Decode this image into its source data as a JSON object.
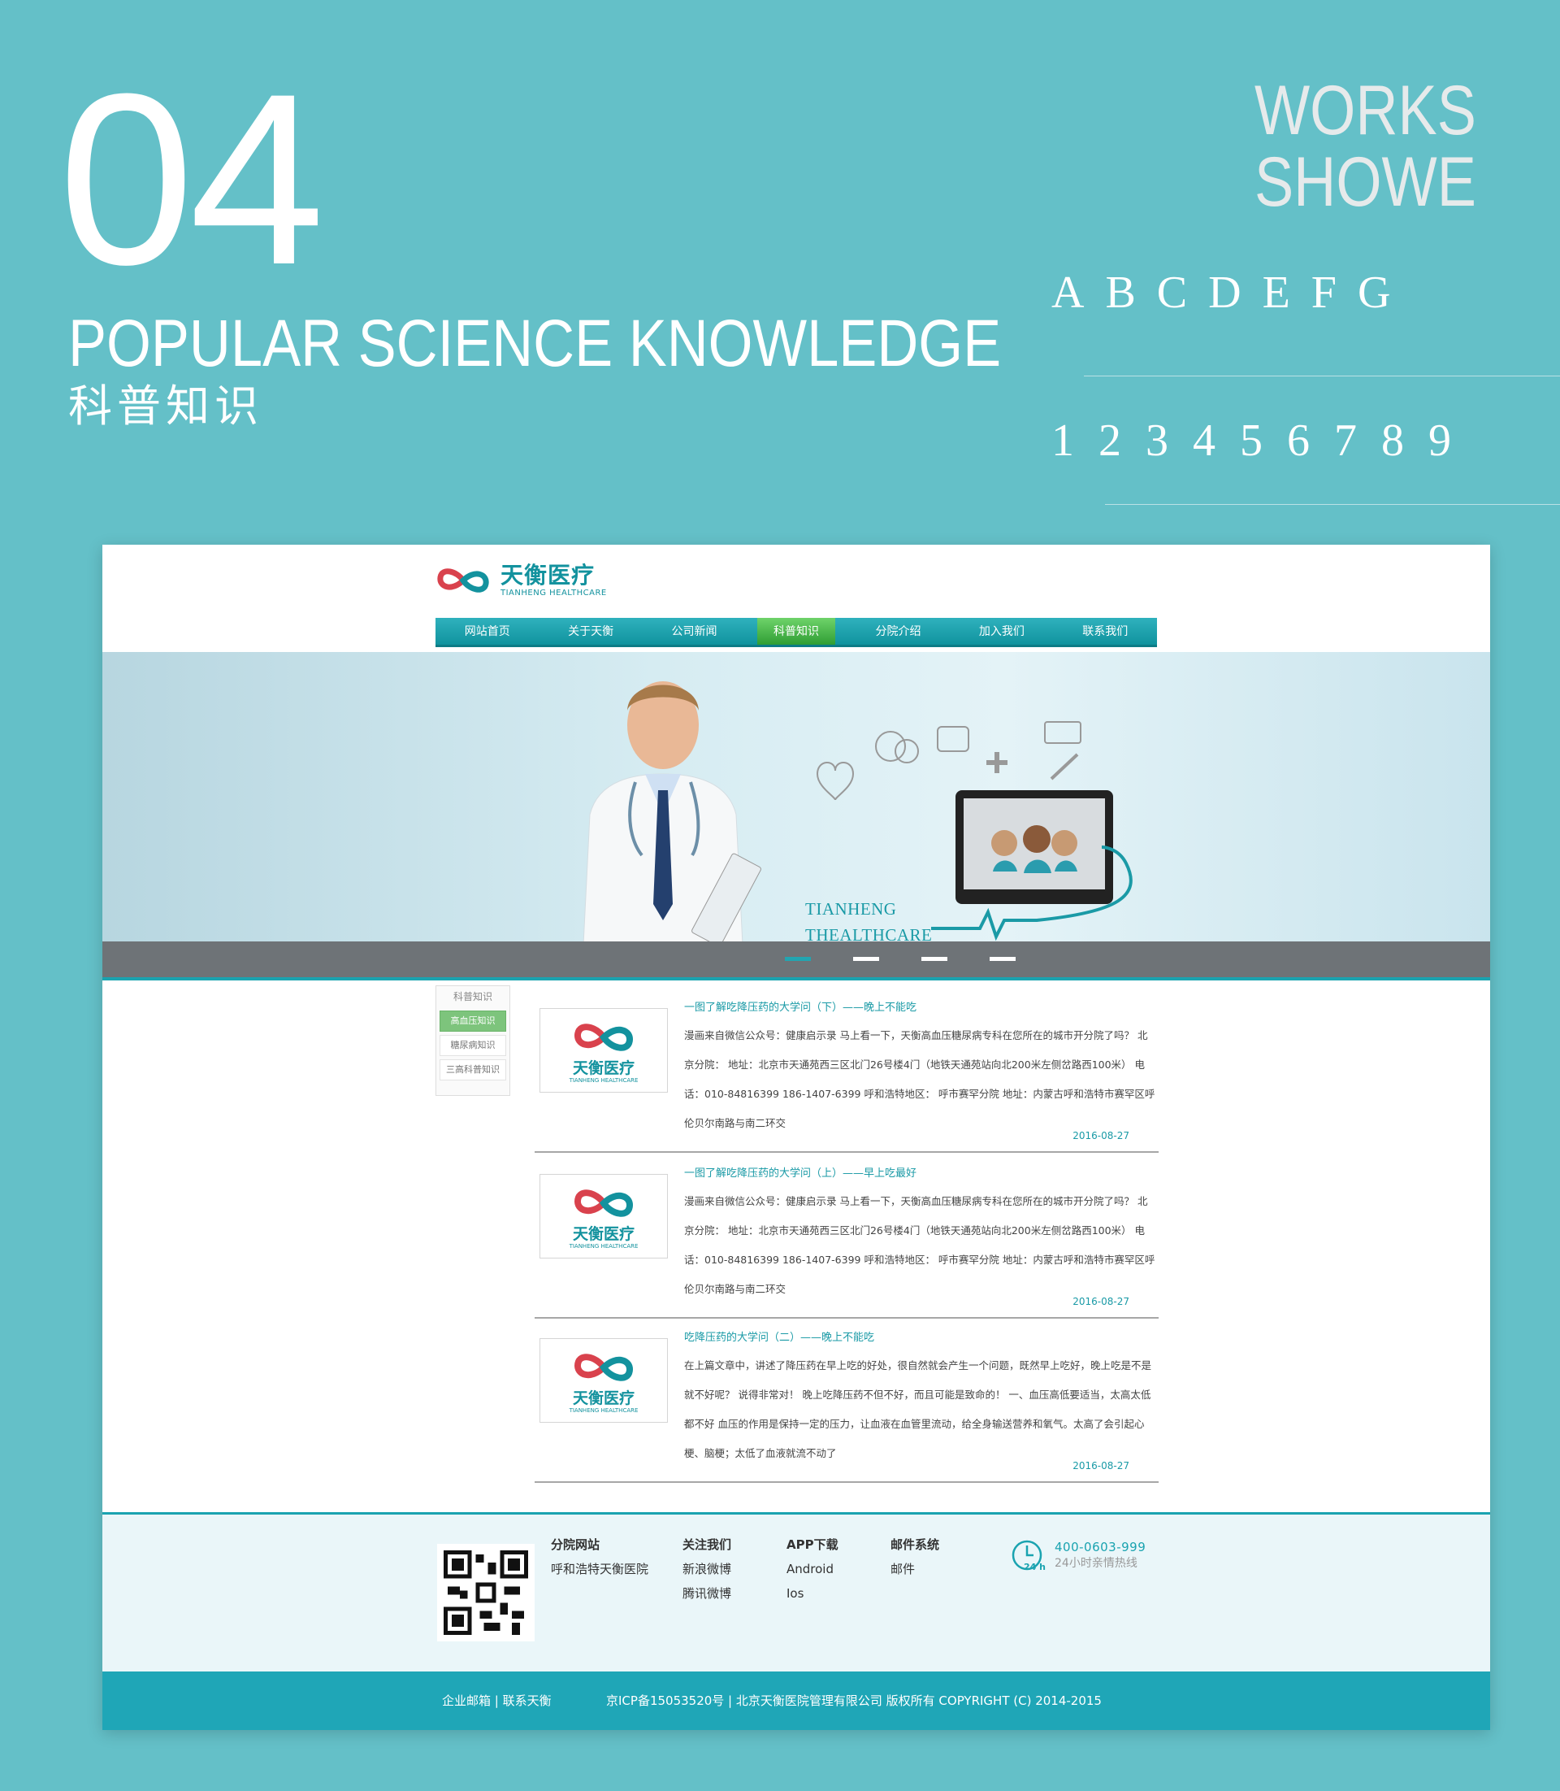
{
  "showcase": {
    "number": "04",
    "title": "POPULAR SCIENCE KNOWLEDGE",
    "title_cn": "科普知识",
    "works_line1": "WORKS",
    "works_line2": "SHOWE",
    "letters": "ABCDEFG",
    "digits": "123456789"
  },
  "site": {
    "logo_cn": "天衡医疗",
    "logo_en": "TIANHENG HEALTHCARE",
    "nav": [
      "网站首页",
      "关于天衡",
      "公司新闻",
      "科普知识",
      "分院介绍",
      "加入我们",
      "联系我们"
    ],
    "nav_active": "科普知识",
    "banner_line1": "TIANHENG",
    "banner_line2": "THEALTHCARE",
    "side_title": "科普知识",
    "side_items": [
      "高血压知识",
      "糖尿病知识",
      "三高科普知识"
    ],
    "articles": [
      {
        "title": "一图了解吃降压药的大学问（下）——晚上不能吃",
        "body": "漫画来自微信公众号：健康启示录 马上看一下，天衡高血压糖尿病专科在您所在的城市开分院了吗？ 北京分院： 地址：北京市天通苑西三区北门26号楼4门（地铁天通苑站向北200米左侧岔路西100米） 电话：010-84816399 186-1407-6399 呼和浩特地区： 呼市赛罕分院 地址：内蒙古呼和浩特市赛罕区呼伦贝尔南路与南二环交",
        "date": "2016-08-27"
      },
      {
        "title": "一图了解吃降压药的大学问（上）——早上吃最好",
        "body": "漫画来自微信公众号：健康启示录 马上看一下，天衡高血压糖尿病专科在您所在的城市开分院了吗？ 北京分院： 地址：北京市天通苑西三区北门26号楼4门（地铁天通苑站向北200米左侧岔路西100米） 电话：010-84816399 186-1407-6399 呼和浩特地区： 呼市赛罕分院 地址：内蒙古呼和浩特市赛罕区呼伦贝尔南路与南二环交",
        "date": "2016-08-27"
      },
      {
        "title": "吃降压药的大学问（二）——晚上不能吃",
        "body": "在上篇文章中，讲述了降压药在早上吃的好处，很自然就会产生一个问题，既然早上吃好，晚上吃是不是就不好呢？ 说得非常对！ 晚上吃降压药不但不好，而且可能是致命的！ 一、血压高低要适当，太高太低都不好 血压的作用是保持一定的压力，让血液在血管里流动，给全身输送营养和氧气。太高了会引起心梗、脑梗；太低了血液就流不动了",
        "date": "2016-08-27"
      }
    ],
    "footer": {
      "col1_head": "分院网站",
      "col1_items": [
        "呼和浩特天衡医院"
      ],
      "col2_head": "关注我们",
      "col2_items": [
        "新浪微博",
        "腾讯微博"
      ],
      "col3_head": "APP下载",
      "col3_items": [
        "Android",
        "Ios"
      ],
      "col4_head": "邮件系统",
      "col4_items": [
        "邮件"
      ],
      "clock_label": "24 h",
      "hotline_number": "400-0603-999",
      "hotline_text": "24小时亲情热线"
    },
    "bottom": {
      "links": "企业邮箱 | 联系天衡",
      "copyright": "京ICP备15053520号 | 北京天衡医院管理有限公司 版权所有 COPYRIGHT (C) 2014-2015"
    }
  },
  "colors": {
    "background": "#64c0c8",
    "accent": "#1aa3b0",
    "active_nav": "#3aaa3e",
    "brand_red": "#d9424d"
  }
}
